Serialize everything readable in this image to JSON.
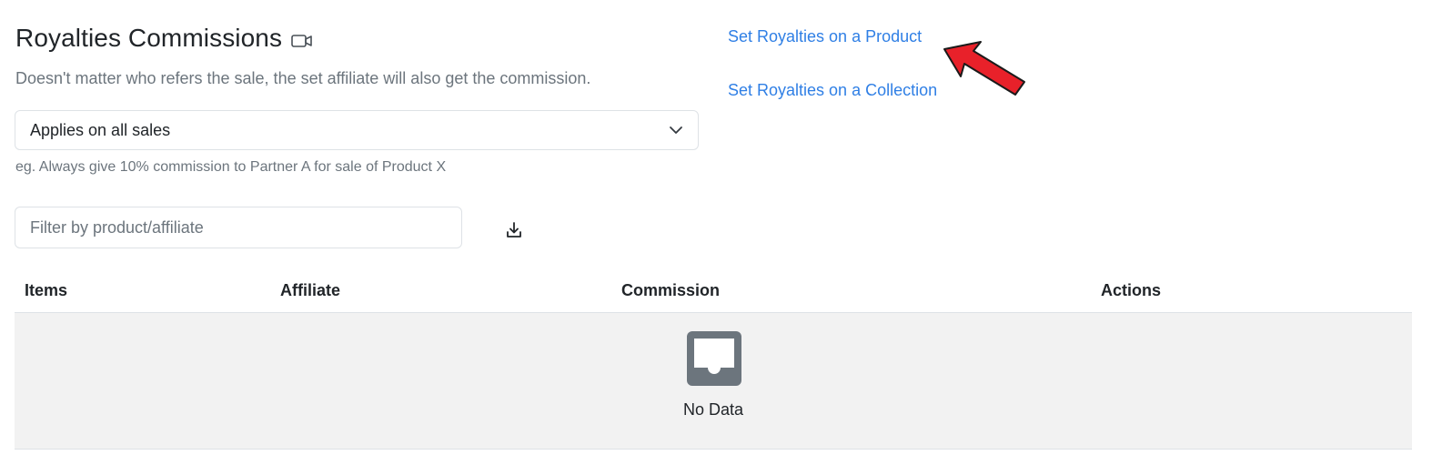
{
  "header": {
    "title": "Royalties Commissions",
    "video_icon": "video-camera-icon",
    "subtitle": "Doesn't matter who refers the sale, the set affiliate will also get the commission."
  },
  "scope_select": {
    "value": "Applies on all sales",
    "hint": "eg. Always give 10% commission to Partner A for sale of Product X"
  },
  "links": {
    "product": "Set Royalties on a Product",
    "collection": "Set Royalties on a Collection"
  },
  "annotation": {
    "arrow_color": "#e8212a"
  },
  "filter": {
    "placeholder": "Filter by product/affiliate",
    "value": "",
    "download_icon": "download-icon"
  },
  "table": {
    "columns": [
      "Items",
      "Affiliate",
      "Commission",
      "Actions"
    ],
    "rows": [],
    "empty_text": "No Data",
    "empty_icon": "inbox-icon"
  },
  "colors": {
    "link": "#2f7fe5",
    "muted_text": "#6c757d",
    "empty_bg": "#f2f2f2"
  }
}
